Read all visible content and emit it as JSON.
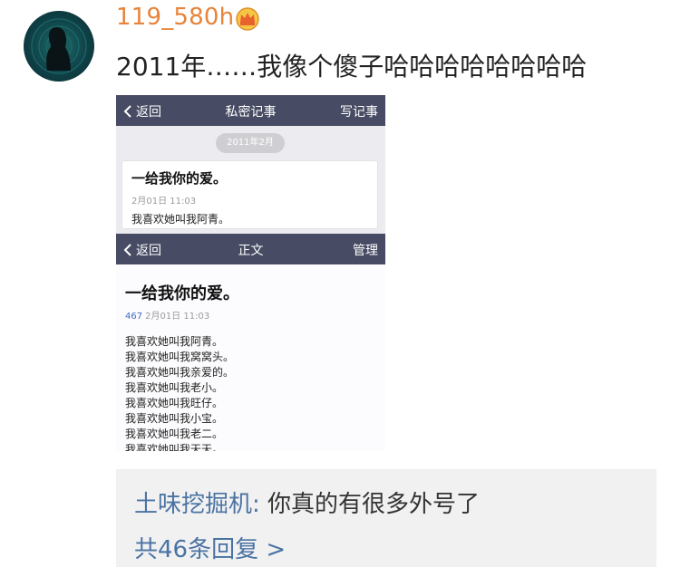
{
  "post": {
    "username": "119_580h",
    "text": "2011年……我像个傻子哈哈哈哈哈哈哈哈"
  },
  "screenshot": {
    "list_nav": {
      "back_label": "返回",
      "title": "私密记事",
      "right_label": "写记事"
    },
    "date_pill": "2011年2月",
    "note_card": {
      "title": "一给我你的爱。",
      "time": "2月01日 11:03",
      "snippet": "我喜欢她叫我阿青。"
    },
    "detail_nav": {
      "back_label": "返回",
      "title": "正文",
      "right_label": "管理"
    },
    "detail": {
      "title": "一给我你的爱。",
      "word_count": "467",
      "time": "2月01日 11:03",
      "lines": [
        "我喜欢她叫我阿青。",
        "我喜欢她叫我窝窝头。",
        "我喜欢她叫我亲爱的。",
        "我喜欢她叫我老小。",
        "我喜欢她叫我旺仔。",
        "我喜欢她叫我小宝。",
        "我喜欢她叫我老二。",
        "我喜欢她叫我天天。"
      ]
    }
  },
  "comment": {
    "commenter": "土味挖掘机",
    "colon": ":",
    "text": " 你真的有很多外号了",
    "reply_link": "共46条回复 >"
  },
  "icons": {
    "avatar": "silhouette-avatar-icon",
    "badge": "crown-badge-icon",
    "back": "chevron-left-icon"
  },
  "colors": {
    "username": "#e8833a",
    "link": "#4a73a3",
    "navbar": "#474b63"
  }
}
